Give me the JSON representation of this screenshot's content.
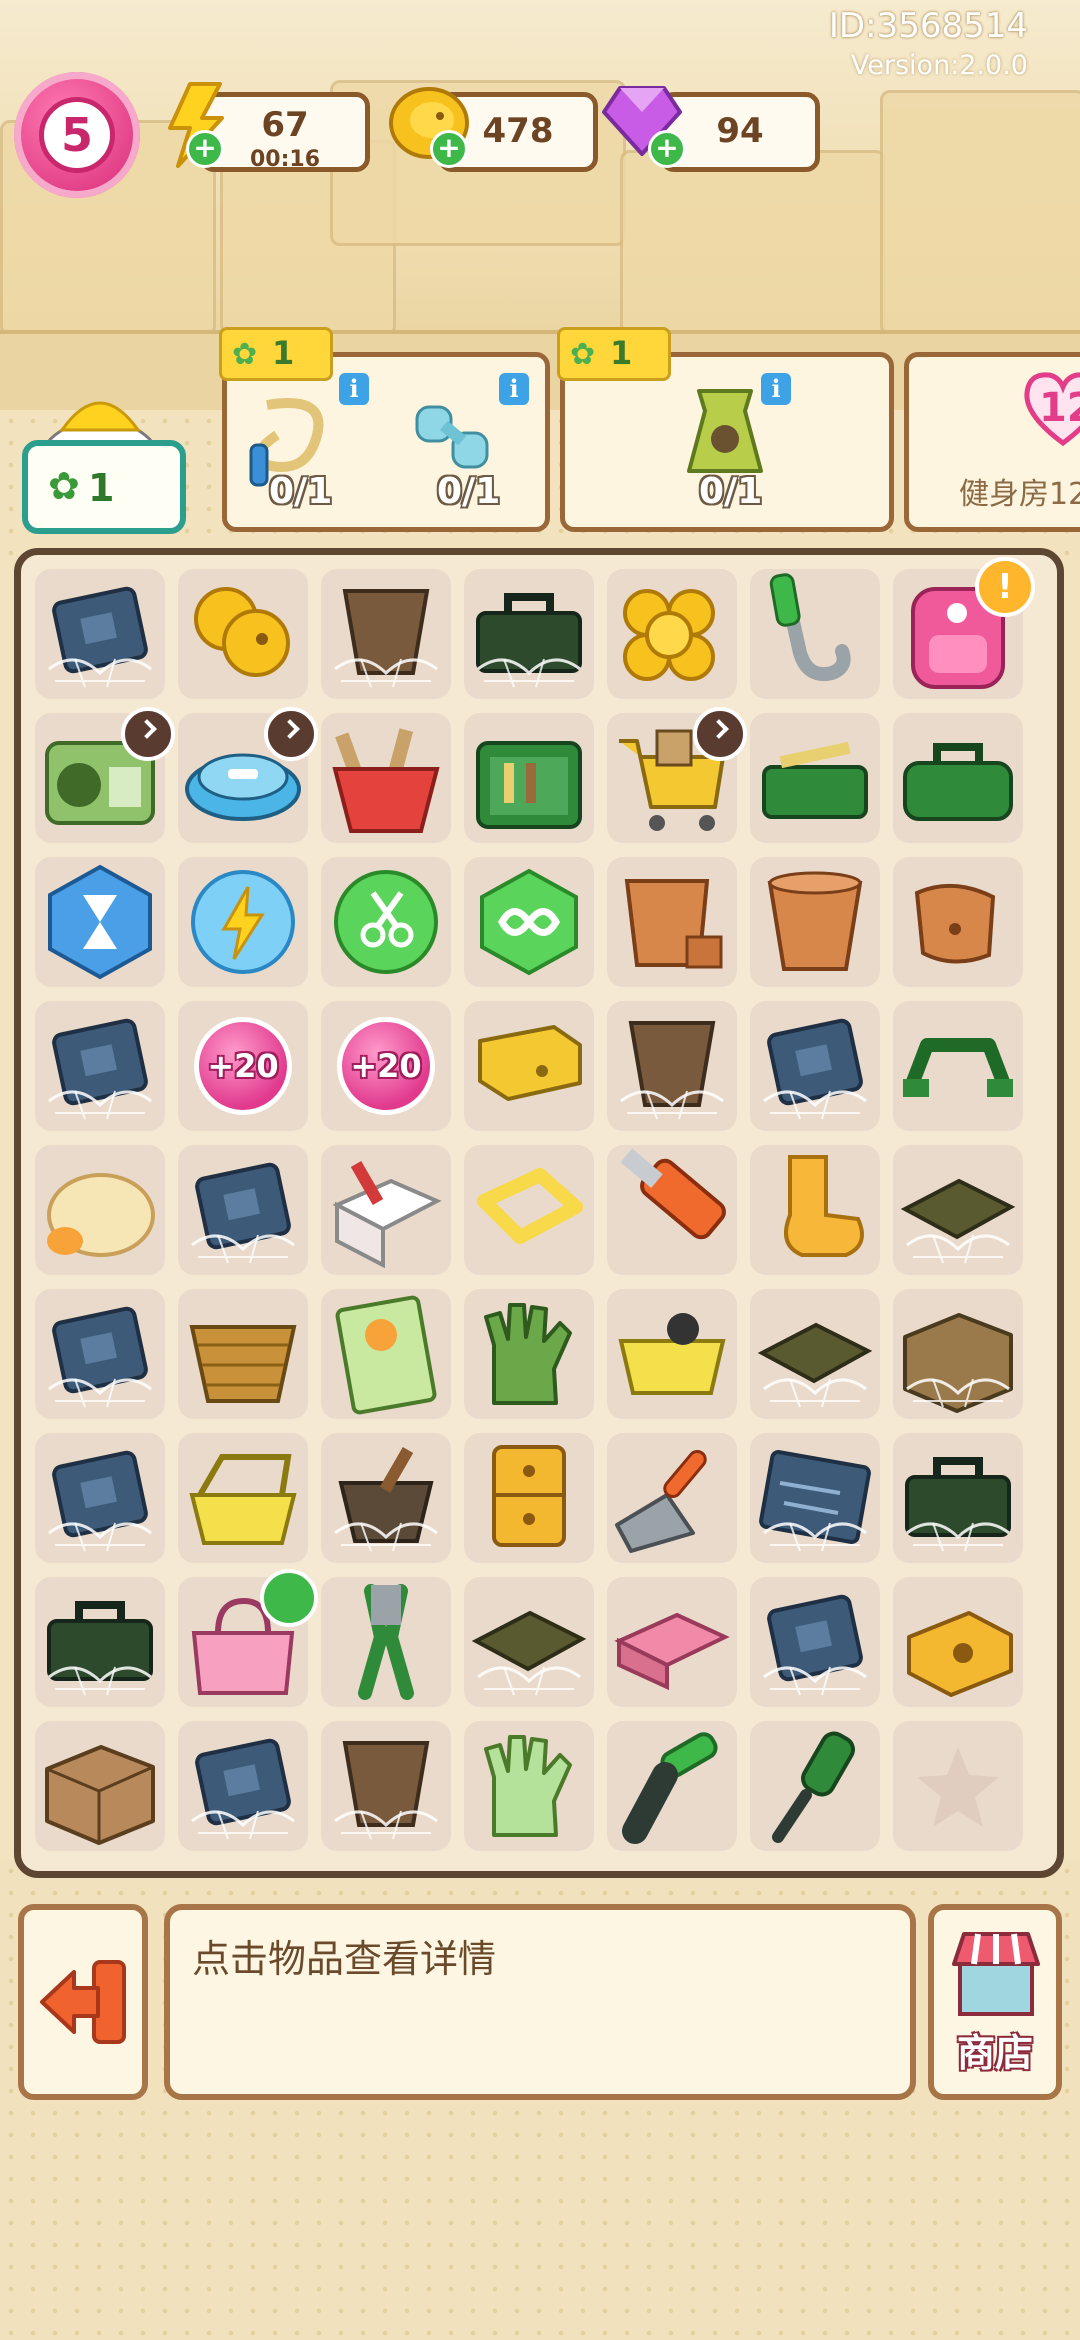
{
  "header": {
    "user_id": "ID:3568514",
    "version": "Version:2.0.0",
    "level": "5",
    "energy": {
      "value": "67",
      "timer": "00:16"
    },
    "coins": {
      "value": "478"
    },
    "gems": {
      "value": "94"
    }
  },
  "requests": {
    "helper_count": "1",
    "cards": [
      {
        "reward": "1",
        "items": [
          {
            "icon": "jump-rope-icon",
            "count": "0/1"
          },
          {
            "icon": "dumbbell-icon",
            "count": "0/1"
          }
        ]
      },
      {
        "reward": "1",
        "items": [
          {
            "icon": "sack-icon",
            "count": "0/1"
          }
        ]
      },
      {
        "heart_value": "12",
        "label": "健身房12"
      }
    ]
  },
  "board": {
    "rows": [
      [
        "cpu-chip-cobweb",
        "gold-coins",
        "bucket-cobweb",
        "toolbox-cobweb",
        "gold-coins-pile",
        "crowbar",
        "backpack"
      ],
      [
        "radio",
        "robot-vacuum",
        "basket-tools",
        "tool-case",
        "shopping-cart",
        "toolbox-tools",
        "toolbox-green"
      ],
      [
        "hourglass-gem",
        "energy-orb",
        "scissors-orb",
        "infinity-gem",
        "clay-pot-broken",
        "clay-pot",
        "clay-shard"
      ],
      [
        "cpu-chip-cobweb",
        "pill-plus-20",
        "pill-plus-20",
        "drawer",
        "bucket-cobweb",
        "cpu-chip-cobweb",
        "handle"
      ],
      [
        "ice-cream",
        "cpu-chip-cobweb",
        "paint-box",
        "frame",
        "utility-knife",
        "sock",
        "tray-cobweb"
      ],
      [
        "cpu-chip-cobweb",
        "wicker-basket",
        "seed-packet",
        "glove-green",
        "basket-yellow",
        "tray-cobweb",
        "cardboard-box-cobweb"
      ],
      [
        "cpu-chip-cobweb",
        "basket-yellow-open",
        "mortar-cobweb",
        "cabinet",
        "trowel",
        "circuit-board-cobweb",
        "toolbox-cobweb"
      ],
      [
        "toolbox-cobweb",
        "pink-bag",
        "pliers",
        "tray-cobweb",
        "bricks",
        "cpu-chip-cobweb",
        "pencil-sharpener"
      ],
      [
        "cardboard-box",
        "cpu-chip-cobweb",
        "bucket-cobweb",
        "glove-light",
        "pipe-wrench",
        "screwdriver",
        "empty-star"
      ]
    ],
    "pill_label": "+20"
  },
  "bottom": {
    "info_text": "点击物品查看详情",
    "shop_label": "商店",
    "exit_icon": "exit-arrow-icon"
  },
  "colors": {
    "accent_pink": "#e23f86",
    "panel_border": "#8b5a2b",
    "board_border": "#5d4632",
    "plus_green": "#3fb84a"
  }
}
